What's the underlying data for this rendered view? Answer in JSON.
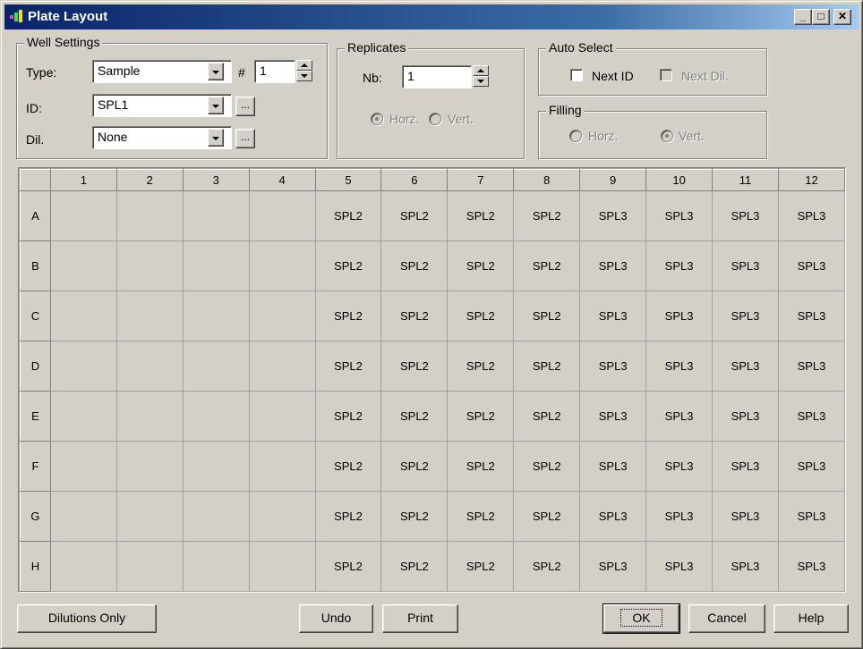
{
  "window": {
    "title": "Plate Layout",
    "controls": {
      "minimize": "_",
      "maximize": "□",
      "close": "✕"
    }
  },
  "well_settings": {
    "group_label": "Well Settings",
    "type_label": "Type:",
    "type_value": "Sample",
    "number_label": "#",
    "number_value": "1",
    "id_label": "ID:",
    "id_value": "SPL1",
    "dil_label": "Dil.",
    "dil_value": "None",
    "browse_label": "..."
  },
  "replicates": {
    "group_label": "Replicates",
    "nb_label": "Nb:",
    "nb_value": "1",
    "horz_label": "Horz.",
    "vert_label": "Vert.",
    "horz_checked": true,
    "vert_checked": false
  },
  "auto_select": {
    "group_label": "Auto Select",
    "next_id_label": "Next ID",
    "next_id_checked": false,
    "next_dil_label": "Next Dil.",
    "next_dil_checked": false
  },
  "filling": {
    "group_label": "Filling",
    "horz_label": "Horz.",
    "vert_label": "Vert.",
    "horz_checked": false,
    "vert_checked": true
  },
  "plate": {
    "columns": [
      "1",
      "2",
      "3",
      "4",
      "5",
      "6",
      "7",
      "8",
      "9",
      "10",
      "11",
      "12"
    ],
    "rows": [
      {
        "label": "A",
        "cells": [
          "",
          "",
          "",
          "",
          "SPL2",
          "SPL2",
          "SPL2",
          "SPL2",
          "SPL3",
          "SPL3",
          "SPL3",
          "SPL3"
        ]
      },
      {
        "label": "B",
        "cells": [
          "",
          "",
          "",
          "",
          "SPL2",
          "SPL2",
          "SPL2",
          "SPL2",
          "SPL3",
          "SPL3",
          "SPL3",
          "SPL3"
        ]
      },
      {
        "label": "C",
        "cells": [
          "",
          "",
          "",
          "",
          "SPL2",
          "SPL2",
          "SPL2",
          "SPL2",
          "SPL3",
          "SPL3",
          "SPL3",
          "SPL3"
        ]
      },
      {
        "label": "D",
        "cells": [
          "",
          "",
          "",
          "",
          "SPL2",
          "SPL2",
          "SPL2",
          "SPL2",
          "SPL3",
          "SPL3",
          "SPL3",
          "SPL3"
        ]
      },
      {
        "label": "E",
        "cells": [
          "",
          "",
          "",
          "",
          "SPL2",
          "SPL2",
          "SPL2",
          "SPL2",
          "SPL3",
          "SPL3",
          "SPL3",
          "SPL3"
        ]
      },
      {
        "label": "F",
        "cells": [
          "",
          "",
          "",
          "",
          "SPL2",
          "SPL2",
          "SPL2",
          "SPL2",
          "SPL3",
          "SPL3",
          "SPL3",
          "SPL3"
        ]
      },
      {
        "label": "G",
        "cells": [
          "",
          "",
          "",
          "",
          "SPL2",
          "SPL2",
          "SPL2",
          "SPL2",
          "SPL3",
          "SPL3",
          "SPL3",
          "SPL3"
        ]
      },
      {
        "label": "H",
        "cells": [
          "",
          "",
          "",
          "",
          "SPL2",
          "SPL2",
          "SPL2",
          "SPL2",
          "SPL3",
          "SPL3",
          "SPL3",
          "SPL3"
        ]
      }
    ]
  },
  "buttons": {
    "dilutions_only": "Dilutions Only",
    "undo": "Undo",
    "print": "Print",
    "ok": "OK",
    "cancel": "Cancel",
    "help": "Help"
  }
}
